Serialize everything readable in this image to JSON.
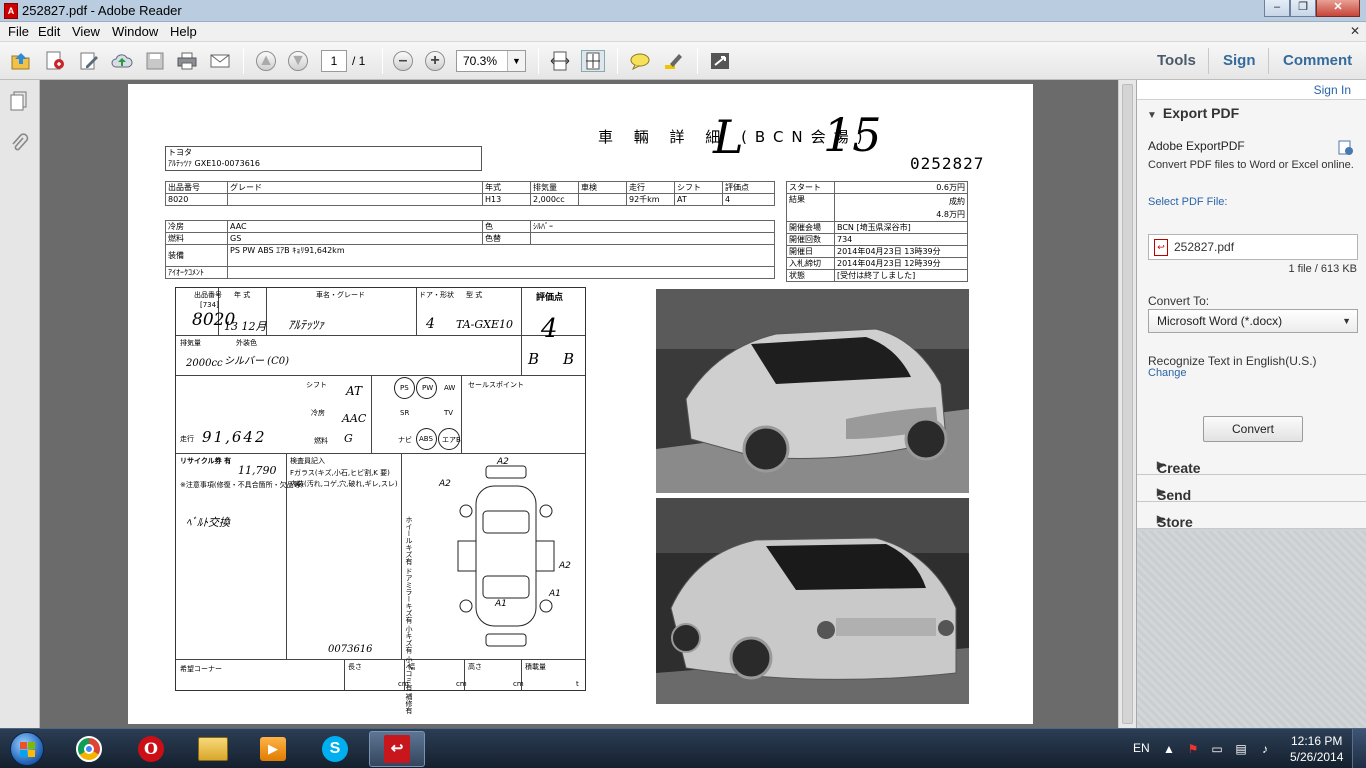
{
  "window": {
    "title": "252827.pdf - Adobe Reader",
    "controls": [
      "–",
      "❐",
      "✕"
    ]
  },
  "menu": {
    "items": [
      "File",
      "Edit",
      "View",
      "Window",
      "Help"
    ],
    "close": "✕"
  },
  "toolbar": {
    "page_current": "1",
    "page_total": "/ 1",
    "zoom": "70.3%",
    "tools_label": "Tools",
    "sign_label": "Sign",
    "comment_label": "Comment"
  },
  "document": {
    "title": "車 輛 詳 細 (BCN会場)",
    "handwritten_lane": "L",
    "handwritten_number": "15",
    "doc_number": "0252827",
    "maker": "トヨタ",
    "model_line": "ｱﾙﾃｯﾂｧ GXE10-0073616",
    "info_header": [
      "出品番号",
      "グレード",
      "年式",
      "排気量",
      "車検",
      "走行",
      "シフト",
      "評価点"
    ],
    "info_values": [
      "8020",
      "",
      "H13",
      "2,000cc",
      "",
      "92千km",
      "AT",
      "4"
    ],
    "spec_rows": [
      {
        "label": "冷房",
        "value": "AAC",
        "label2": "色",
        "value2": "ｼﾙﾊﾞｰ"
      },
      {
        "label": "燃料",
        "value": "GS",
        "label2": "色替",
        "value2": ""
      },
      {
        "label": "装備",
        "value": "PS   PW   ABS   ｴｱB   ｷｮﾘ91,642km",
        "label2": "",
        "value2": ""
      },
      {
        "label": "ｱｲｵｰｸｺﾒﾝﾄ",
        "value": "",
        "label2": "",
        "value2": ""
      }
    ],
    "auction_rows": [
      {
        "label": "スタート",
        "value": "0.6万円"
      },
      {
        "label": "結果",
        "value": "成約\n4.8万円"
      },
      {
        "label": "開催会場",
        "value": "BCN [埼玉県深谷市]"
      },
      {
        "label": "開催回数",
        "value": "734"
      },
      {
        "label": "開催日",
        "value": "2014年04月23日 13時39分"
      },
      {
        "label": "入札締切",
        "value": "2014年04月23日 12時39分"
      },
      {
        "label": "状態",
        "value": "[受付は終了しました]"
      }
    ],
    "sheet": {
      "lot_label": "出品番号",
      "lot_sub": "[734]",
      "lot_number": "8020",
      "year_label": "年 式",
      "year_value": "13 12月",
      "name_label": "車名・グレード",
      "name_value": "ｱﾙﾃｯﾂｧ",
      "doors_label": "ドア・形状",
      "doors_value": "4",
      "type_label": "型 式",
      "type_value": "TA-GXE10",
      "grade_label": "評価点",
      "grade_value": "4",
      "exhaust_label": "排気量",
      "exhaust_value": "2000cc",
      "color_label": "外装色",
      "color_value": "シルバー (C0)",
      "interior_a": "B",
      "interior_b": "B",
      "shift_label": "シフト",
      "shift_value": "AT",
      "ac_label": "冷房",
      "ac_value": "AAC",
      "mileage_label": "走行",
      "mileage_value": "91,642",
      "fuel_label": "燃料",
      "fuel_value": "G",
      "equip": [
        "PS",
        "PW",
        "AW",
        "SR",
        "TV",
        "ナビ",
        "ABS",
        "エアB"
      ],
      "sales_point": "セールスポイント",
      "recycle_label": "リサイクル券 有",
      "recycle_value": "11,790",
      "inspector_label": "検査員記入",
      "inspector_text1": "Fガラス(キズ,小石,ヒビ割,K 要)",
      "inspector_text2": "内装(汚れ,コゲ,穴,破れ,ギレ,スレ)",
      "notes_label": "※注意事項(修復・不具合箇所・欠品等)",
      "notes_value": "ﾍﾞﾙﾄ交換",
      "vin": "0073616",
      "damage_marks": [
        "A2",
        "A2",
        "A2",
        "A1",
        "A1"
      ],
      "side_note": "ホイールキズ有 ドアミラーキズ有 小キズ有 小ヘコミ有 補修有",
      "footer": [
        "希望コーナー",
        "長さ",
        "幅",
        "高さ",
        "積載量"
      ],
      "footer_units": [
        "cm",
        "cm",
        "cm",
        "t"
      ]
    },
    "photos": [
      "car-front-photo",
      "car-rear-photo"
    ]
  },
  "right_panel": {
    "sign_in": "Sign In",
    "export_header": "Export PDF",
    "adobe_export": "Adobe ExportPDF",
    "export_desc": "Convert PDF files to Word or Excel online.",
    "select_label": "Select PDF File:",
    "file_name": "252827.pdf",
    "file_info": "1 file / 613 KB",
    "convert_to_label": "Convert To:",
    "convert_to_value": "Microsoft Word (*.docx)",
    "recognize_text": "Recognize Text in English(U.S.)",
    "change_link": "Change",
    "convert_button": "Convert",
    "sections": [
      "Create PDF",
      "Send Files",
      "Store Files"
    ]
  },
  "taskbar": {
    "apps": [
      "chrome",
      "opera",
      "explorer",
      "media",
      "skype",
      "adobe-reader"
    ],
    "lang": "EN",
    "time": "12:16 PM",
    "date": "5/26/2014"
  }
}
